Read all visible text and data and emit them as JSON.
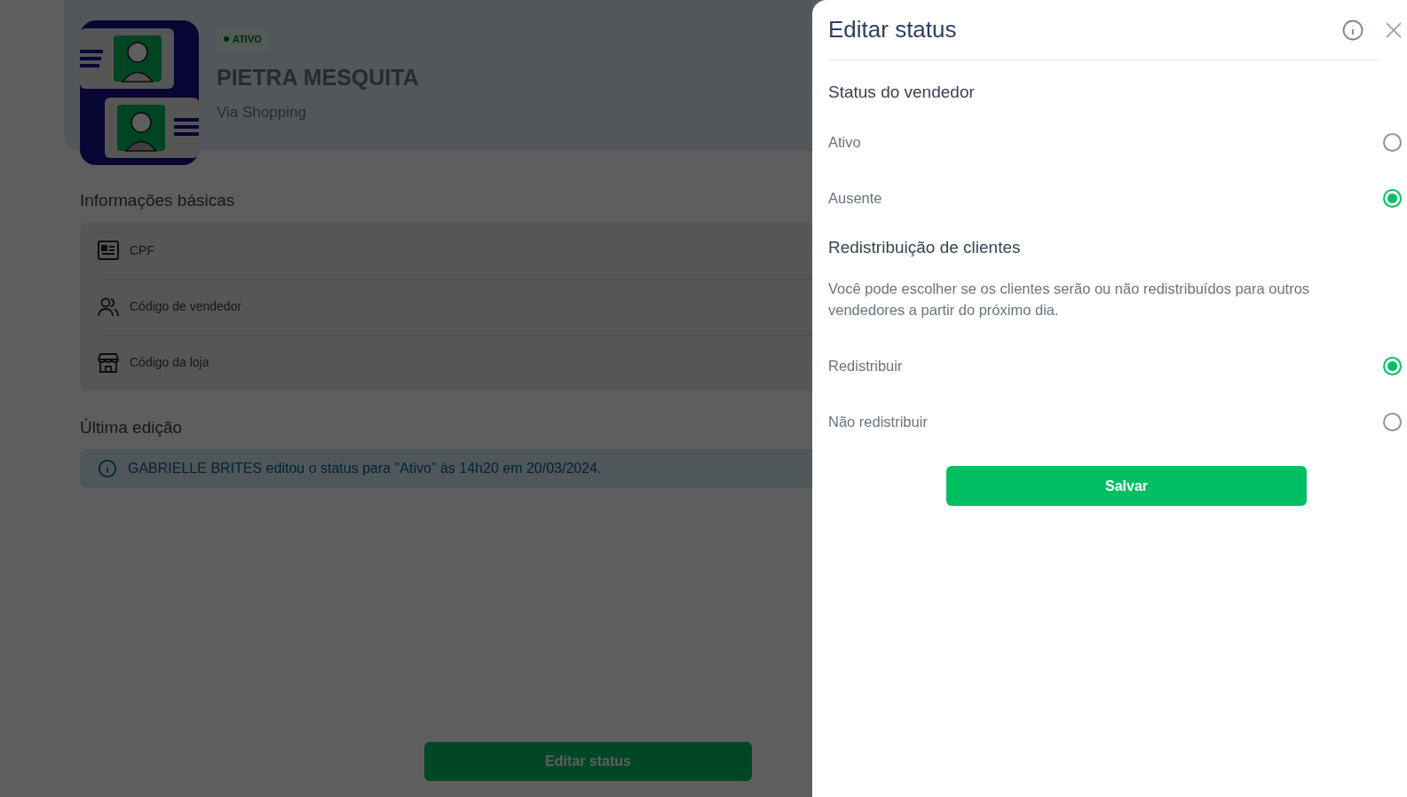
{
  "profile": {
    "badge": "ATIVO",
    "name": "PIETRA MESQUITA",
    "store": "Via Shopping"
  },
  "basic_info": {
    "title": "Informações básicas",
    "rows": [
      {
        "kind": "id-card",
        "label": "CPF"
      },
      {
        "kind": "people",
        "label": "Código de vendedor"
      },
      {
        "kind": "store",
        "label": "Código da loja"
      }
    ]
  },
  "last_edit": {
    "title": "Última edição",
    "message": "GABRIELLE BRITES editou o status para \"Ativo\" às 14h20 em 20/03/2024."
  },
  "edit_button": "Editar status",
  "panel": {
    "title": "Editar status",
    "status": {
      "title": "Status do vendedor",
      "options": [
        {
          "label": "Ativo",
          "selected": false
        },
        {
          "label": "Ausente",
          "selected": true
        }
      ]
    },
    "redistribution": {
      "title": "Redistribuição de clientes",
      "description": "Você pode escolher se os clientes serão ou não redistribuídos para outros vendedores a partir do próximo dia.",
      "options": [
        {
          "label": "Redistribuir",
          "selected": true
        },
        {
          "label": "Não redistribuir",
          "selected": false
        }
      ]
    },
    "save_button": "Salvar"
  }
}
